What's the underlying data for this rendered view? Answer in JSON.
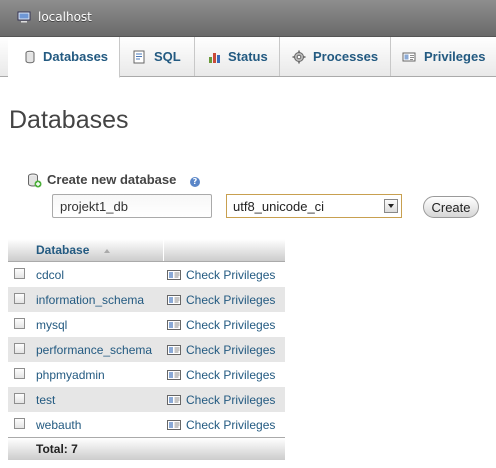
{
  "server": {
    "label": "localhost"
  },
  "tabs": [
    {
      "label": "Databases",
      "icon": "database-icon",
      "active": true
    },
    {
      "label": "SQL",
      "icon": "sql-icon"
    },
    {
      "label": "Status",
      "icon": "status-chart-icon"
    },
    {
      "label": "Processes",
      "icon": "gears-icon"
    },
    {
      "label": "Privileges",
      "icon": "privileges-icon"
    }
  ],
  "page": {
    "title": "Databases"
  },
  "create_db": {
    "label": "Create new database",
    "name_value": "projekt1_db",
    "collation_value": "utf8_unicode_ci",
    "button_label": "Create"
  },
  "table": {
    "header_database": "Database",
    "rows": [
      {
        "name": "cdcol",
        "action": "Check Privileges"
      },
      {
        "name": "information_schema",
        "action": "Check Privileges"
      },
      {
        "name": "mysql",
        "action": "Check Privileges"
      },
      {
        "name": "performance_schema",
        "action": "Check Privileges"
      },
      {
        "name": "phpmyadmin",
        "action": "Check Privileges"
      },
      {
        "name": "test",
        "action": "Check Privileges"
      },
      {
        "name": "webauth",
        "action": "Check Privileges"
      }
    ],
    "total_label": "Total: 7"
  },
  "colors": {
    "link": "#235a81",
    "server_bar": "#7a7a7a",
    "row_alt": "#e6e6e6"
  }
}
